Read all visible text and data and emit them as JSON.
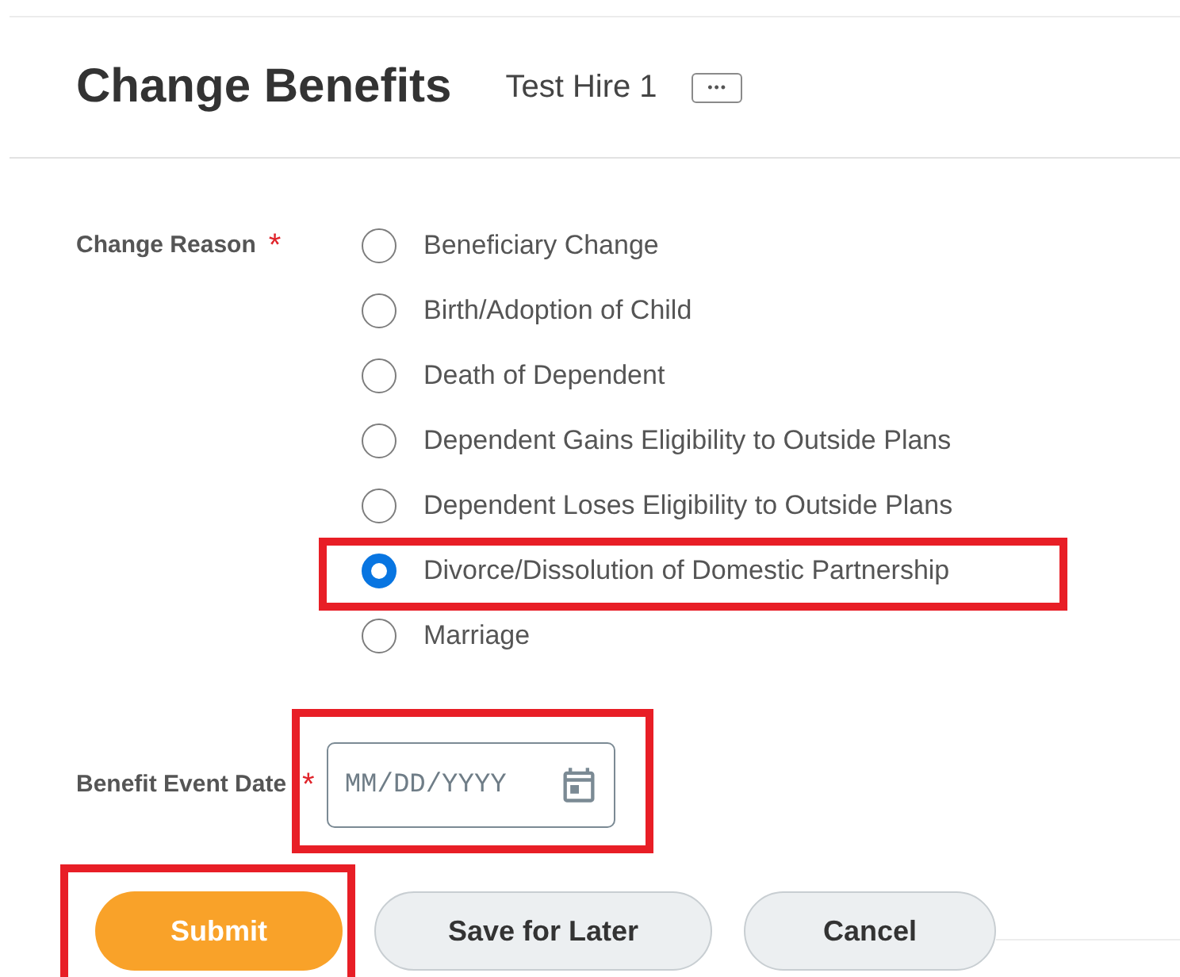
{
  "header": {
    "title": "Change Benefits",
    "subtitle": "Test Hire 1",
    "more_button": "•••"
  },
  "change_reason": {
    "label": "Change Reason",
    "required_mark": "*",
    "options": [
      {
        "label": "Beneficiary Change",
        "selected": false,
        "highlighted": false
      },
      {
        "label": "Birth/Adoption of Child",
        "selected": false,
        "highlighted": false
      },
      {
        "label": "Death of Dependent",
        "selected": false,
        "highlighted": false
      },
      {
        "label": "Dependent Gains Eligibility to Outside Plans",
        "selected": false,
        "highlighted": false
      },
      {
        "label": "Dependent Loses Eligibility to Outside Plans",
        "selected": false,
        "highlighted": false
      },
      {
        "label": "Divorce/Dissolution of Domestic Partnership",
        "selected": true,
        "highlighted": true
      },
      {
        "label": "Marriage",
        "selected": false,
        "highlighted": false
      }
    ]
  },
  "benefit_event_date": {
    "label": "Benefit Event Date",
    "required_mark": "*",
    "placeholder": "MM/DD/YYYY",
    "highlighted": true
  },
  "buttons": [
    {
      "label": "Submit",
      "kind": "primary",
      "highlighted": true
    },
    {
      "label": "Save for Later",
      "kind": "secondary",
      "highlighted": false
    },
    {
      "label": "Cancel",
      "kind": "secondary",
      "highlighted": false
    }
  ]
}
